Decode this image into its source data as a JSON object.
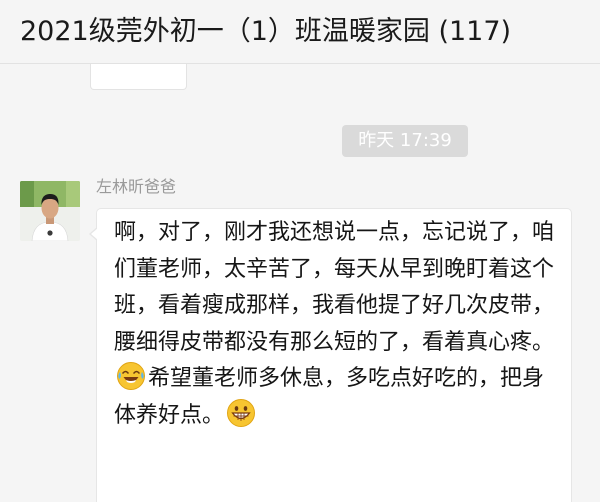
{
  "chat": {
    "title": "2021级莞外初一（1）班温暖家园 (117)"
  },
  "timestamp": {
    "label": "昨天 17:39"
  },
  "message": {
    "sender": "左林昕爸爸",
    "text_part1": "啊，对了，刚才我还想说一点，忘记说了，咱们董老师，太辛苦了，每天从早到晚盯着这个班，看着瘦成那样，我看他提了好几次皮带，腰细得皮带都没有那么短的了，看着真心疼。",
    "emoji1": "crying-laughing-emoji",
    "text_part2": "希望董老师多休息，多吃点好吃的，把身体养好点。",
    "emoji2": "grinning-emoji"
  },
  "colors": {
    "background": "#f5f5f5",
    "bubble": "#ffffff",
    "sender_name": "#9a9a9a",
    "time_pill": "#dadada"
  }
}
